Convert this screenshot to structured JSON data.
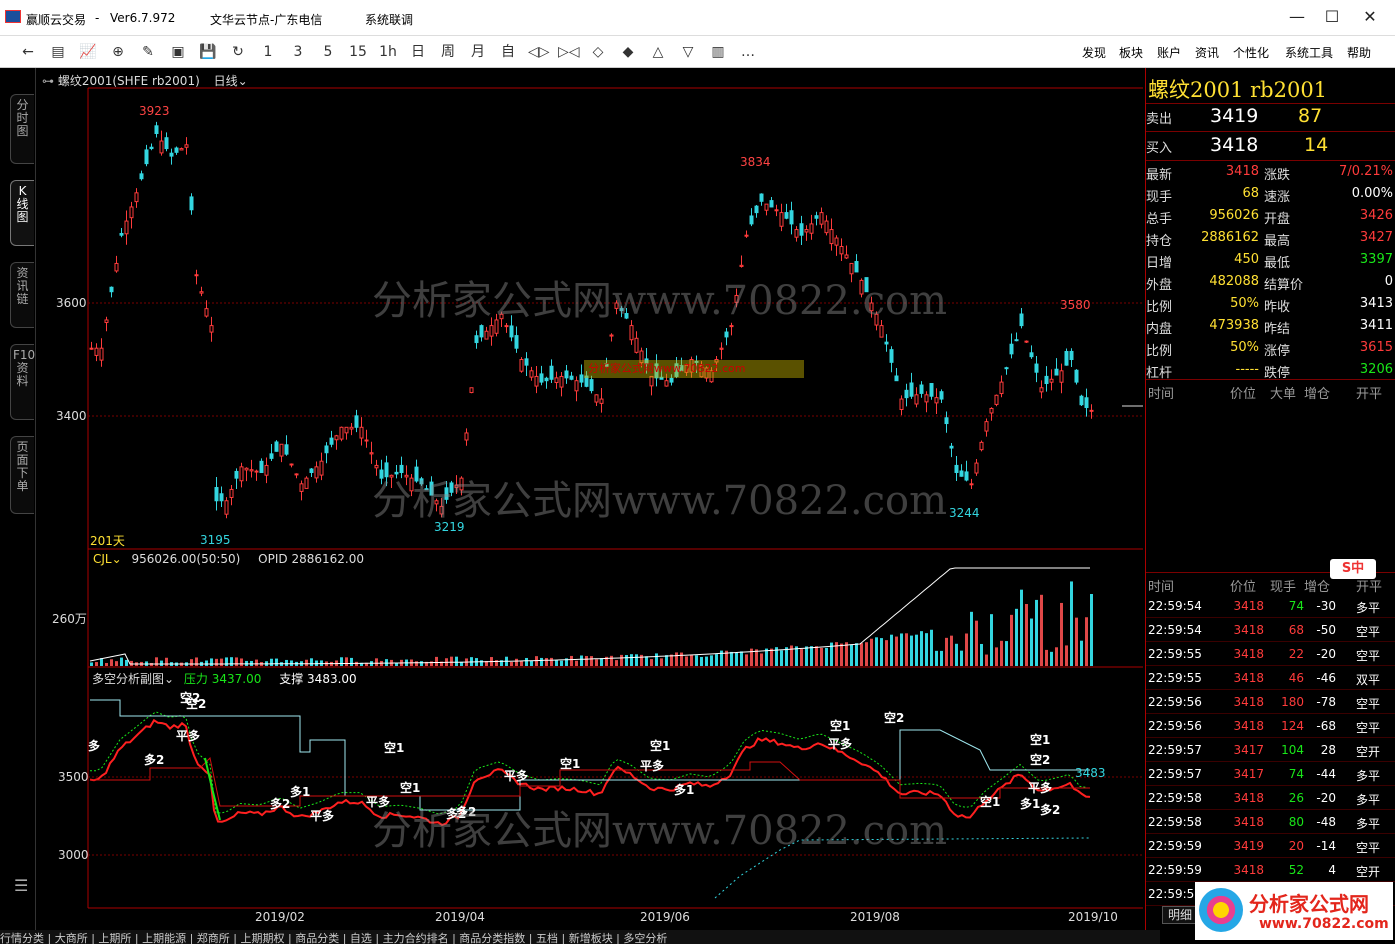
{
  "window": {
    "app_name": "赢顺云交易",
    "dash": "-",
    "version": "Ver6.7.972",
    "node": "文华云节点-广东电信",
    "status": "系统联调",
    "min": "—",
    "max": "☐",
    "close": "✕"
  },
  "toolbar": {
    "icons": [
      "←",
      "▤",
      "📈",
      "⊕",
      "✎",
      "▣",
      "💾",
      "↻",
      "1",
      "3",
      "5",
      "15",
      "1h",
      "日",
      "周",
      "月",
      "自",
      "◁▷",
      "▷◁",
      "◇",
      "◆",
      "△",
      "▽",
      "▥",
      "…"
    ],
    "menus": [
      "发现",
      "板块",
      "账户",
      "资讯",
      "个性化",
      "系统工具",
      "帮助"
    ]
  },
  "sidebar": {
    "tabs": [
      "分时图",
      "K线图",
      "资讯链",
      "F10资料",
      "页面下单"
    ],
    "menu_icon": "☰"
  },
  "chart_header": {
    "instrument": "螺纹2001(SHFE rb2001)",
    "period": "日线",
    "icon": "link-icon"
  },
  "price_panel": {
    "y_ticks": [
      "3600",
      "3400"
    ],
    "labels": {
      "high": "3923",
      "peak2": "3834",
      "p3": "3580",
      "low1": "3195",
      "low2": "3219",
      "low3": "3244"
    },
    "days": "201天"
  },
  "volume_panel": {
    "label": "CJL",
    "value": "956026.00(50:50)",
    "opid": "OPID 2886162.00",
    "y_tick": "260万"
  },
  "indicator_panel": {
    "name": "多空分析副图",
    "pressure_label": "压力",
    "pressure_value": "3437.00",
    "support_label": "支撑",
    "support_value": "3483.00",
    "y_ticks": [
      "3500",
      "3000"
    ],
    "last_value": "3483",
    "signals": [
      "空2",
      "平多",
      "多2",
      "多",
      "空2",
      "空1",
      "多1",
      "多2",
      "平多",
      "空1",
      "多2",
      "平多",
      "空1",
      "平多",
      "空1",
      "多1",
      "空1",
      "平多",
      "空2",
      "空1",
      "平多",
      "空2",
      "空1",
      "多1",
      "平多",
      "多2",
      "多2"
    ]
  },
  "x_axis": {
    "ticks": [
      "2019/02",
      "2019/04",
      "2019/06",
      "2019/08",
      "2019/10"
    ]
  },
  "watermark": {
    "text": "分析家公式网www.70822.com",
    "small": "分析家公式网www.70822.com"
  },
  "quote": {
    "title": "螺纹2001  rb2001",
    "sell_label": "卖出",
    "sell_price": "3419",
    "sell_vol": "87",
    "buy_label": "买入",
    "buy_price": "3418",
    "buy_vol": "14",
    "rows": [
      {
        "l1": "最新",
        "v1": "3418",
        "c1": "red",
        "l2": "涨跌",
        "v2": "7/0.21%",
        "c2": "red"
      },
      {
        "l1": "现手",
        "v1": "68",
        "c1": "yel",
        "l2": "速涨",
        "v2": "0.00%",
        "c2": "wht"
      },
      {
        "l1": "总手",
        "v1": "956026",
        "c1": "yel",
        "l2": "开盘",
        "v2": "3426",
        "c2": "red"
      },
      {
        "l1": "持仓",
        "v1": "2886162",
        "c1": "yel",
        "l2": "最高",
        "v2": "3427",
        "c2": "red"
      },
      {
        "l1": "日增",
        "v1": "450",
        "c1": "yel",
        "l2": "最低",
        "v2": "3397",
        "c2": "grn"
      },
      {
        "l1": "外盘",
        "v1": "482088",
        "c1": "yel",
        "l2": "结算价",
        "v2": "0",
        "c2": "wht"
      },
      {
        "l1": "比例",
        "v1": "50%",
        "c1": "yel",
        "l2": "昨收",
        "v2": "3413",
        "c2": "wht"
      },
      {
        "l1": "内盘",
        "v1": "473938",
        "c1": "yel",
        "l2": "昨结",
        "v2": "3411",
        "c2": "wht"
      },
      {
        "l1": "比例",
        "v1": "50%",
        "c1": "yel",
        "l2": "涨停",
        "v2": "3615",
        "c2": "red"
      },
      {
        "l1": "杠杆",
        "v1": "-----",
        "c1": "yel",
        "l2": "跌停",
        "v2": "3206",
        "c2": "grn"
      }
    ],
    "tick_head1": [
      "时间",
      "价位",
      "大单",
      "增仓",
      "开平"
    ],
    "tick_head2": [
      "时间",
      "价位",
      "现手",
      "增仓",
      "开平"
    ],
    "ime": "S中",
    "trades": [
      {
        "t": "22:59:54",
        "p": "3418",
        "pc": "red",
        "v": "74",
        "vc": "grn",
        "d": "-30",
        "k": "多平"
      },
      {
        "t": "22:59:54",
        "p": "3418",
        "pc": "red",
        "v": "68",
        "vc": "red",
        "d": "-50",
        "k": "空平"
      },
      {
        "t": "22:59:55",
        "p": "3418",
        "pc": "red",
        "v": "22",
        "vc": "red",
        "d": "-20",
        "k": "空平"
      },
      {
        "t": "22:59:55",
        "p": "3418",
        "pc": "red",
        "v": "46",
        "vc": "red",
        "d": "-46",
        "k": "双平"
      },
      {
        "t": "22:59:56",
        "p": "3418",
        "pc": "red",
        "v": "180",
        "vc": "red",
        "d": "-78",
        "k": "空平"
      },
      {
        "t": "22:59:56",
        "p": "3418",
        "pc": "red",
        "v": "124",
        "vc": "red",
        "d": "-68",
        "k": "空平"
      },
      {
        "t": "22:59:57",
        "p": "3417",
        "pc": "red",
        "v": "104",
        "vc": "grn",
        "d": "28",
        "k": "空开"
      },
      {
        "t": "22:59:57",
        "p": "3417",
        "pc": "red",
        "v": "74",
        "vc": "grn",
        "d": "-44",
        "k": "多平"
      },
      {
        "t": "22:59:58",
        "p": "3418",
        "pc": "red",
        "v": "26",
        "vc": "grn",
        "d": "-20",
        "k": "多平"
      },
      {
        "t": "22:59:58",
        "p": "3418",
        "pc": "red",
        "v": "80",
        "vc": "grn",
        "d": "-48",
        "k": "多平"
      },
      {
        "t": "22:59:59",
        "p": "3419",
        "pc": "red",
        "v": "20",
        "vc": "red",
        "d": "-14",
        "k": "空平"
      },
      {
        "t": "22:59:59",
        "p": "3418",
        "pc": "red",
        "v": "52",
        "vc": "grn",
        "d": "4",
        "k": "空开"
      },
      {
        "t": "22:59:5",
        "p": "",
        "pc": "red",
        "v": "",
        "vc": "red",
        "d": "",
        "k": ""
      }
    ],
    "detail_tab": "明细"
  },
  "bottom_tabs": "行情分类 | 大商所 | 上期所 | 上期能源 | 郑商所 | 上期期权 | 商品分类 | 自选 | 主力合约排名 | 商品分类指数 | 五档 | 新增板块 | 多空分析",
  "brand": {
    "text": "分析家公式网",
    "url": "www.70822.com"
  },
  "colors": {
    "up": "#ff3b3b",
    "down": "#33d6e0",
    "bg": "#000000",
    "grid": "#7a0000",
    "accent": "#ffe033"
  }
}
